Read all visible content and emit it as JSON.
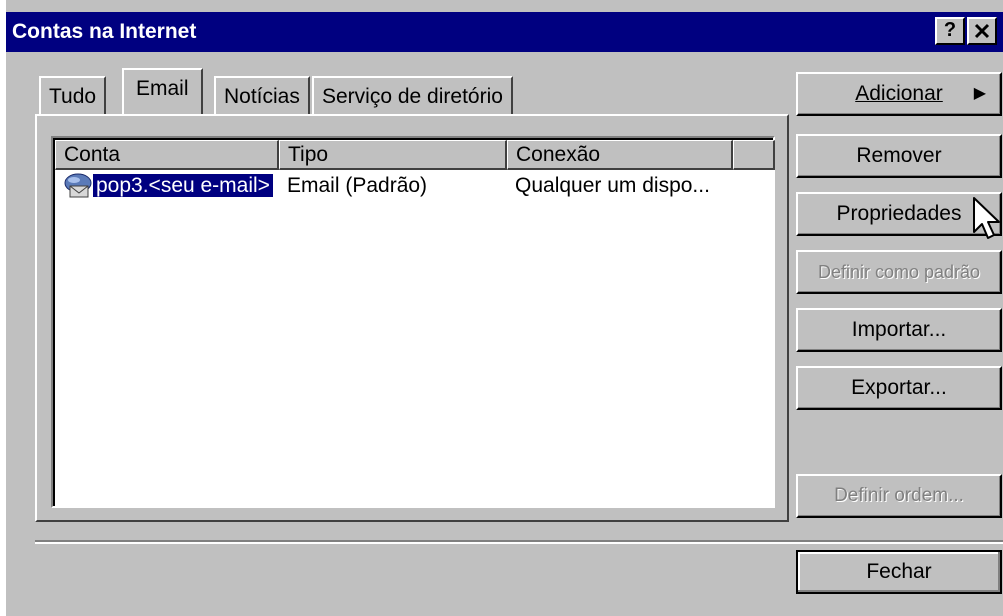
{
  "window": {
    "title": "Contas na Internet",
    "help_button": "?",
    "close_button": "✕"
  },
  "tabs": [
    {
      "label": "Tudo",
      "active": false
    },
    {
      "label": "Email",
      "active": true
    },
    {
      "label": "Notícias",
      "active": false
    },
    {
      "label": "Serviço de diretório",
      "active": false
    }
  ],
  "list": {
    "columns": [
      "Conta",
      "Tipo",
      "Conexão"
    ],
    "rows": [
      {
        "conta": "pop3.<seu e-mail>",
        "tipo": "Email (Padrão)",
        "conexao": "Qualquer um dispo...",
        "icon": "mail-account-icon",
        "selected": true
      }
    ]
  },
  "buttons": {
    "adicionar": "Adicionar",
    "remover": "Remover",
    "propriedades": "Propriedades",
    "definir_padrao": "Definir como padrão",
    "importar": "Importar...",
    "exportar": "Exportar...",
    "definir_ordem": "Definir ordem...",
    "fechar": "Fechar"
  },
  "colors": {
    "titlebar": "#000080",
    "selection": "#000080",
    "face": "#c0c0c0"
  }
}
